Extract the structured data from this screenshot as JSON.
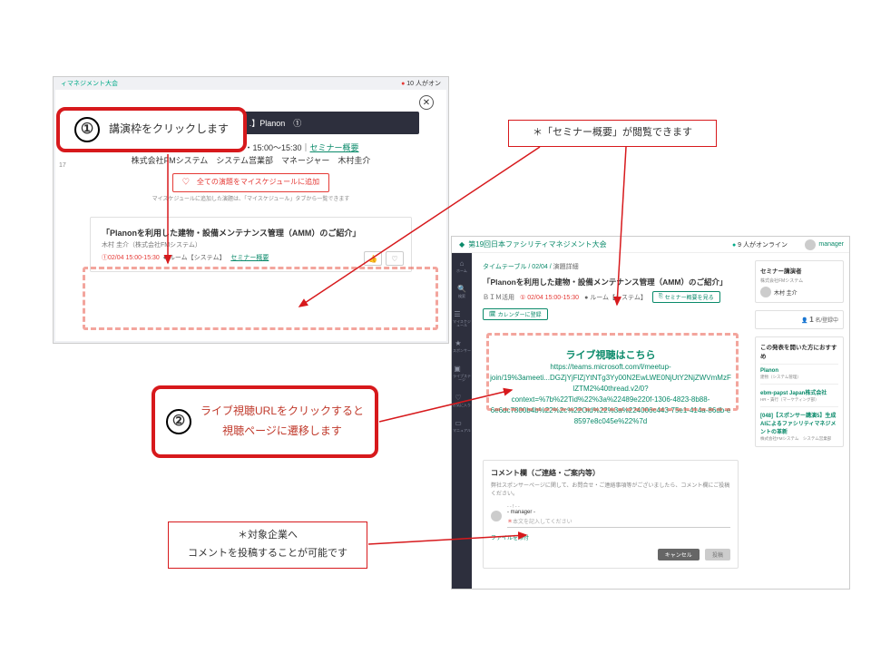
{
  "callouts": {
    "c1_num": "①",
    "c1_text": "講演枠をクリックします",
    "c2_num": "②",
    "c2_line1": "ライブ視聴URLをクリックすると",
    "c2_line2": "視聴ページに遷移します",
    "c3_text": "＊「セミナー概要」が閲覧できます",
    "c4_line1": "＊対象企業へ",
    "c4_line2": "コメントを投稿することが可能です"
  },
  "modal": {
    "topbar_left": "ィマネジメント大会",
    "online_count": "10",
    "online_suffix": "人がオン",
    "darkbar": "【. . . . . . . . . .】Planon　①",
    "room_time": "ルーム【システム】｜02/04・15:00～15:30｜",
    "seminar_link": "セミナー概要",
    "company_line": "株式会社FMシステム　システム営業部　マネージャー　木村圭介",
    "add_all_btn": "♡　全ての演題をマイスケジュールに追加",
    "hint": "マイスケジュールに追加した演題は、「マイスケジュール」タブから一覧できます",
    "card": {
      "title": "「Planonを利用した建物・設備メンテナンス管理（AMM）のご紹介」",
      "sub": "木村 圭介（株式会社FMシステム）",
      "time": "①02/04 15:00-15:30",
      "room": "● ルーム【システム】",
      "link": "セミナー概要"
    },
    "side_time": "17"
  },
  "detail": {
    "event_title": "第19回日本ファシリティマネジメント大会",
    "online_count": "9",
    "online_suffix": "人がオンライン",
    "user_name": "manager",
    "sidebar_labels": [
      "ホーム",
      "検索",
      "マイスケジュール",
      "スポンサー",
      "ライブステージ",
      "お気に入り",
      "マニュアル"
    ],
    "breadcrumb_a": "タイムテーブル",
    "breadcrumb_b": "02/04",
    "breadcrumb_c": "演題詳細",
    "title": "「Planonを利用した建物・設備メンテナンス管理（AMM）のご紹介」",
    "meta_cat": "ＢＩＭ活用",
    "meta_time": "① 02/04 15:00-15:30",
    "meta_room": "● ルーム【システム】",
    "btn_overview": "セミナー概要を見る",
    "btn_calendar": "カレンダーに登録",
    "live_heading": "ライブ視聴はこちら",
    "live_url_1": "https://teams.microsoft.com/l/meetup-",
    "live_url_2": "join/19%3ameeti...DGZjYjFlZjYtNTg3Yy00N2EwLWE0NjUtY2NjZWVmMzFlZTM2%40thread.v2/0?",
    "live_url_3": "context=%7b%22Tid%22%3a%22489e220f-1306-4823-8b88-",
    "live_url_4": "6e6dc7800b4b%22%2c%22Oid%22%3a%224006c443-75e1-414a-86db-e8597e8c045e%22%7d",
    "comment": {
      "title": "コメント欄（ご連絡・ご案内等）",
      "subtitle": "弊社スポンサーページに関して、お問合せ・ご連絡事項等がございましたら、コメント欄にご投稿ください。",
      "user_role": "- - ! - -",
      "user_name": "- manager -",
      "placeholder": "本文を記入してください",
      "attach": "ファイルを添付",
      "cancel": "キャンセル",
      "post": "投稿"
    },
    "side_speaker": {
      "heading": "セミナー講演者",
      "company": "株式会社FMシステム",
      "name": "木村 圭介"
    },
    "side_reg": {
      "num": "1",
      "lbl": "名/登録中"
    },
    "side_rec": {
      "heading": "この発表を開いた方におすすめ",
      "items": [
        {
          "cat": "Planon",
          "sub": "建物（システム管理）"
        },
        {
          "cat": "ebm-papst Japan株式会社",
          "sub": "HR・賃行（マーケティング部）"
        },
        {
          "cat": "[048]【スポンサー講演5】生成AIによるファシリティマネジメントの革新",
          "sub": "株式会社FMシステム　システム営業部"
        }
      ]
    }
  }
}
